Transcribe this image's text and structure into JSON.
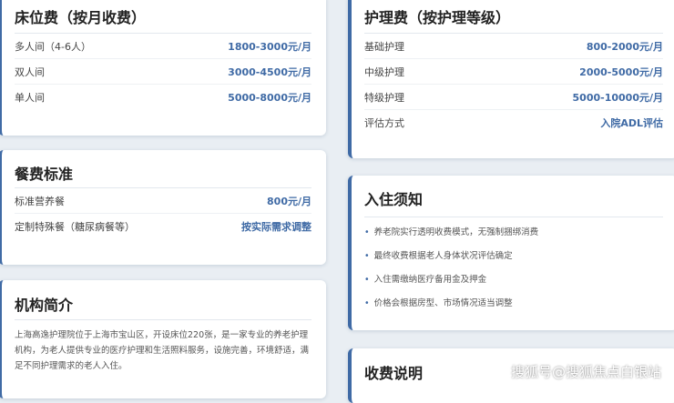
{
  "bed_fee": {
    "title": "床位费（按月收费）",
    "rows": [
      {
        "label": "多人间（4-6人）",
        "value": "1800-3000元/月"
      },
      {
        "label": "双人间",
        "value": "3000-4500元/月"
      },
      {
        "label": "单人间",
        "value": "5000-8000元/月"
      }
    ]
  },
  "care_fee": {
    "title": "护理费（按护理等级）",
    "rows": [
      {
        "label": "基础护理",
        "value": "800-2000元/月"
      },
      {
        "label": "中级护理",
        "value": "2000-5000元/月"
      },
      {
        "label": "特级护理",
        "value": "5000-10000元/月"
      },
      {
        "label": "评估方式",
        "value": "入院ADL评估"
      }
    ]
  },
  "meal": {
    "title": "餐费标准",
    "rows": [
      {
        "label": "标准营养餐",
        "value": "800元/月"
      },
      {
        "label": "定制特殊餐（糖尿病餐等）",
        "value": "按实际需求调整"
      }
    ]
  },
  "notice": {
    "title": "入住须知",
    "items": [
      "养老院实行透明收费模式，无强制捆绑消费",
      "最终收费根据老人身体状况评估确定",
      "入住需缴纳医疗备用金及押金",
      "价格会根据房型、市场情况适当调整"
    ]
  },
  "intro": {
    "title": "机构简介",
    "text": "上海高逸护理院位于上海市宝山区，开设床位220张，是一家专业的养老护理机构，为老人提供专业的医疗护理和生活照料服务，设施完善，环境舒适，满足不同护理需求的老人入住。"
  },
  "fee_note": {
    "title": "收费说明"
  },
  "watermark": "搜狐号@搜狐焦点白银站",
  "colors": {
    "accent": "#3f6aa5",
    "background": "#e9eef3"
  }
}
